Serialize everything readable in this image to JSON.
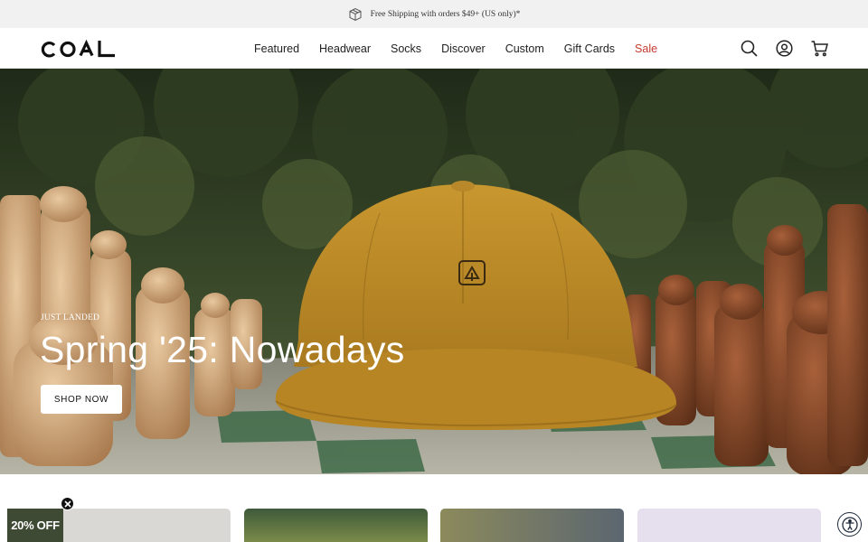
{
  "announcement": {
    "text": "Free Shipping with orders $49+ (US only)*",
    "icon": "box-icon"
  },
  "header": {
    "logo_text": "coal",
    "nav": [
      {
        "label": "Featured"
      },
      {
        "label": "Headwear"
      },
      {
        "label": "Socks"
      },
      {
        "label": "Discover"
      },
      {
        "label": "Custom"
      },
      {
        "label": "Gift Cards"
      },
      {
        "label": "Sale",
        "color": "#c63a2f"
      }
    ],
    "icons": [
      "search-icon",
      "account-icon",
      "cart-icon"
    ]
  },
  "hero": {
    "eyebrow": "JUST LANDED",
    "headline": "Spring '25: Nowadays",
    "cta_label": "SHOP NOW"
  },
  "promo": {
    "label": "20% OFF",
    "bg": "#3f4a35"
  },
  "colors": {
    "sale": "#c63a2f",
    "cap": "#b98a2a"
  }
}
